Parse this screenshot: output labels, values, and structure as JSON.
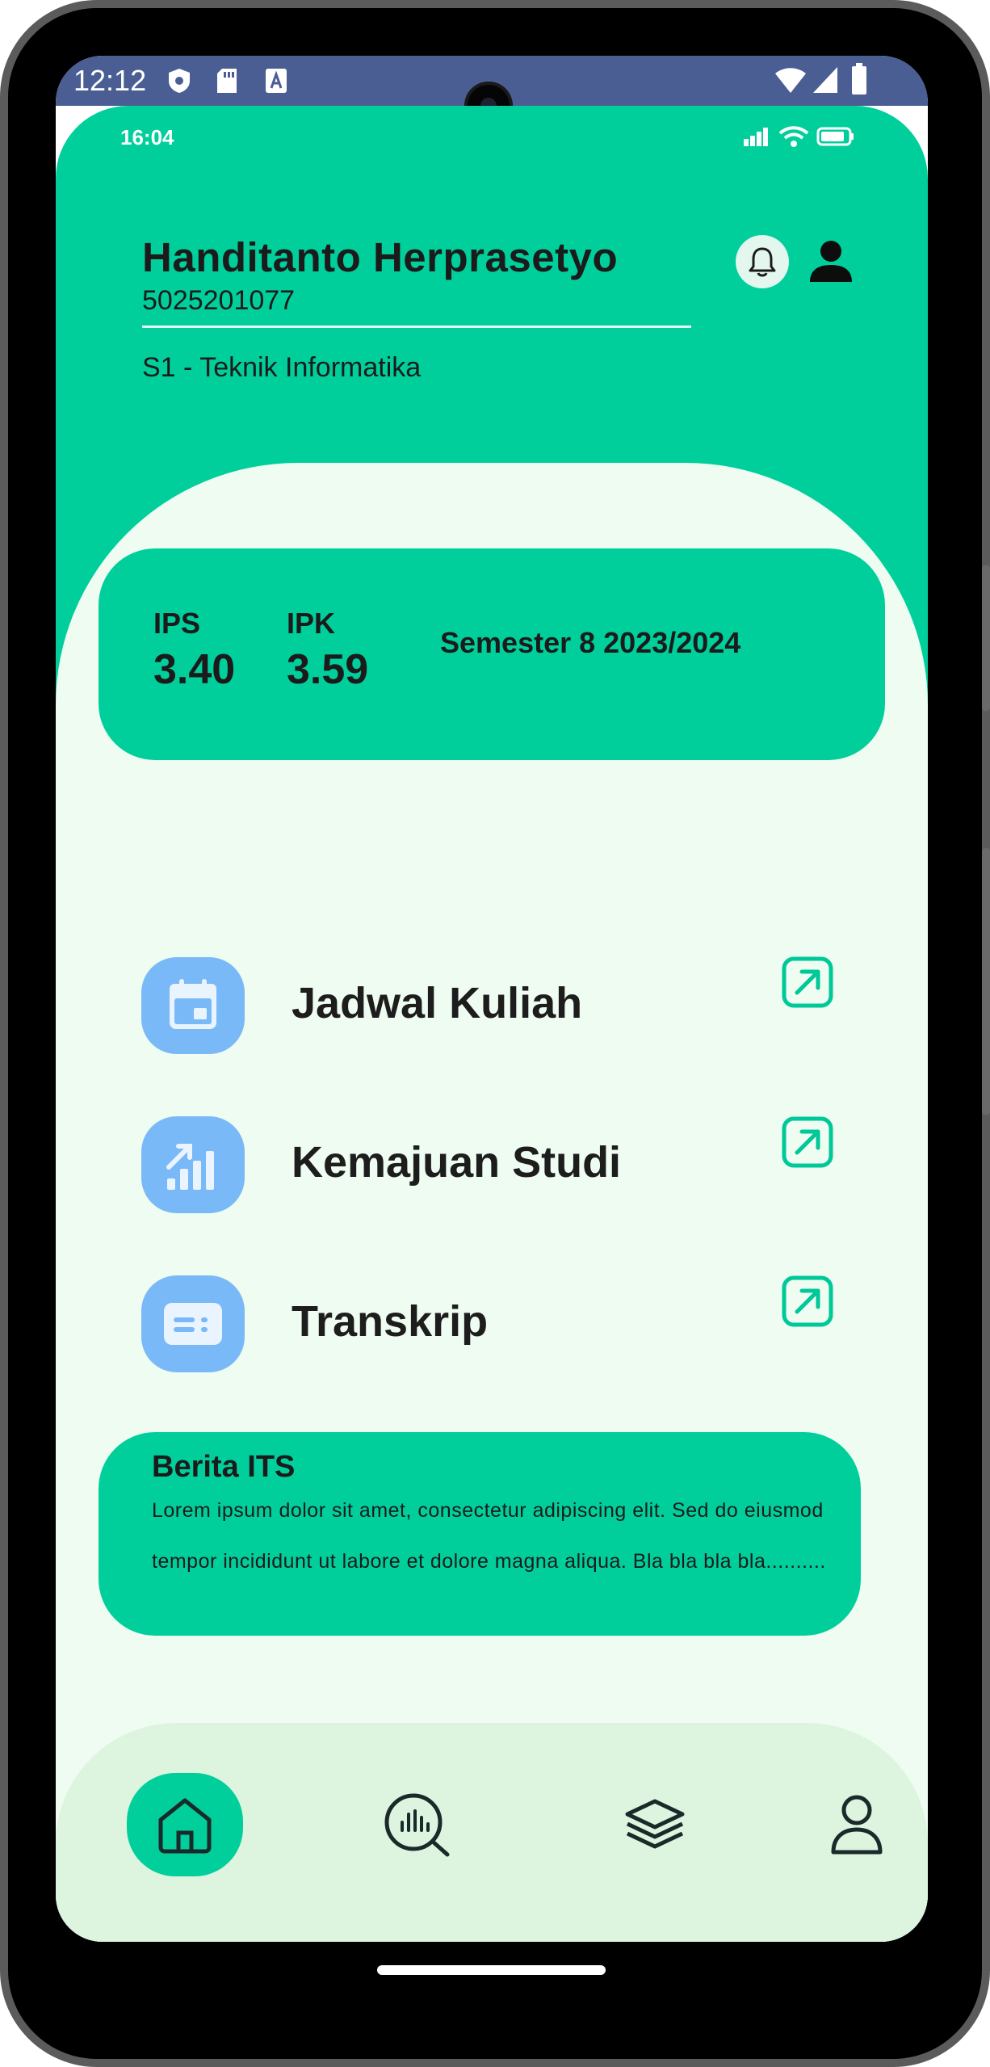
{
  "system_status": {
    "time": "12:12"
  },
  "app_status": {
    "time": "16:04"
  },
  "user": {
    "name": "Handitanto Herprasetyo",
    "nrp": "5025201077",
    "program": "S1 - Teknik Informatika"
  },
  "grades": {
    "ips_label": "IPS",
    "ips_value": "3.40",
    "ipk_label": "IPK",
    "ipk_value": "3.59",
    "semester": "Semester 8 2023/2024"
  },
  "menu": [
    {
      "label": "Jadwal Kuliah",
      "icon": "calendar-icon"
    },
    {
      "label": "Kemajuan Studi",
      "icon": "bar-chart-icon"
    },
    {
      "label": "Transkrip",
      "icon": "document-card-icon"
    }
  ],
  "news": {
    "title": "Berita ITS",
    "body": "Lorem ipsum dolor sit amet, consectetur adipiscing elit. Sed do eiusmod tempor incididunt ut labore et dolore magna aliqua. Bla bla bla bla.........."
  },
  "nav": [
    {
      "icon": "home-icon",
      "active": true
    },
    {
      "icon": "search-chart-icon",
      "active": false
    },
    {
      "icon": "layers-icon",
      "active": false
    },
    {
      "icon": "profile-icon",
      "active": false
    }
  ],
  "colors": {
    "primary": "#00cf9c",
    "background": "#eefcf1",
    "nav_background": "#ddf4df",
    "menu_icon_bg": "#7ab9f8",
    "system_bar": "#4a5e94"
  }
}
